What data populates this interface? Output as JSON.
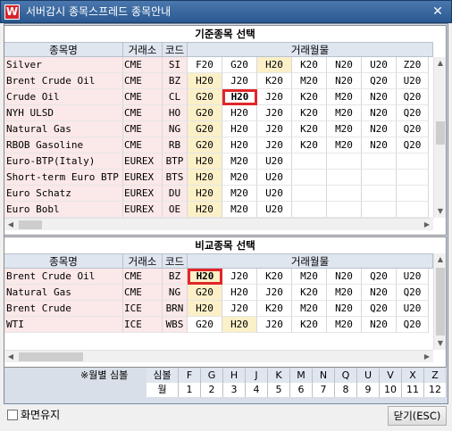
{
  "window": {
    "title": "서버감시 종목스프레드 종목안내",
    "app_icon_letter": "W",
    "close_glyph": "✕"
  },
  "columns": {
    "name": "종목명",
    "exchange": "거래소",
    "code": "코드",
    "months": "거래월물"
  },
  "base": {
    "title": "기준종목 선택",
    "rows": [
      {
        "name": "Silver",
        "exch": "CME",
        "code": "SI",
        "m": [
          "F20",
          "G20",
          "H20",
          "K20",
          "N20",
          "U20",
          "Z20"
        ],
        "hl": [
          2
        ]
      },
      {
        "name": "Brent Crude Oil",
        "exch": "CME",
        "code": "BZ",
        "m": [
          "H20",
          "J20",
          "K20",
          "M20",
          "N20",
          "Q20",
          "U20"
        ],
        "hl": [
          0
        ]
      },
      {
        "name": "Crude Oil",
        "exch": "CME",
        "code": "CL",
        "m": [
          "G20",
          "H20",
          "J20",
          "K20",
          "M20",
          "N20",
          "Q20"
        ],
        "hl": [
          0
        ],
        "sel": 1
      },
      {
        "name": "NYH ULSD",
        "exch": "CME",
        "code": "HO",
        "m": [
          "G20",
          "H20",
          "J20",
          "K20",
          "M20",
          "N20",
          "Q20"
        ],
        "hl": [
          0
        ]
      },
      {
        "name": "Natural Gas",
        "exch": "CME",
        "code": "NG",
        "m": [
          "G20",
          "H20",
          "J20",
          "K20",
          "M20",
          "N20",
          "Q20"
        ],
        "hl": [
          0
        ]
      },
      {
        "name": "RBOB Gasoline",
        "exch": "CME",
        "code": "RB",
        "m": [
          "G20",
          "H20",
          "J20",
          "K20",
          "M20",
          "N20",
          "Q20"
        ],
        "hl": [
          0
        ]
      },
      {
        "name": "Euro-BTP(Italy)",
        "exch": "EUREX",
        "code": "BTP",
        "m": [
          "H20",
          "M20",
          "U20",
          "",
          "",
          "",
          ""
        ],
        "hl": [
          0
        ]
      },
      {
        "name": "Short-term Euro BTP",
        "exch": "EUREX",
        "code": "BTS",
        "m": [
          "H20",
          "M20",
          "U20",
          "",
          "",
          "",
          ""
        ],
        "hl": [
          0
        ]
      },
      {
        "name": "Euro Schatz",
        "exch": "EUREX",
        "code": "DU",
        "m": [
          "H20",
          "M20",
          "U20",
          "",
          "",
          "",
          ""
        ],
        "hl": [
          0
        ]
      },
      {
        "name": "Euro Bobl",
        "exch": "EUREX",
        "code": "OE",
        "m": [
          "H20",
          "M20",
          "U20",
          "",
          "",
          "",
          ""
        ],
        "hl": [
          0
        ]
      }
    ]
  },
  "compare": {
    "title": "비교종목 선택",
    "rows": [
      {
        "name": "Brent Crude Oil",
        "exch": "CME",
        "code": "BZ",
        "m": [
          "H20",
          "J20",
          "K20",
          "M20",
          "N20",
          "Q20",
          "U20"
        ],
        "hl": [
          0
        ],
        "sel": 0
      },
      {
        "name": "Natural Gas",
        "exch": "CME",
        "code": "NG",
        "m": [
          "G20",
          "H20",
          "J20",
          "K20",
          "M20",
          "N20",
          "Q20"
        ],
        "hl": [
          0
        ]
      },
      {
        "name": "Brent Crude",
        "exch": "ICE",
        "code": "BRN",
        "m": [
          "H20",
          "J20",
          "K20",
          "M20",
          "N20",
          "Q20",
          "U20"
        ],
        "hl": [
          0
        ]
      },
      {
        "name": "WTI",
        "exch": "ICE",
        "code": "WBS",
        "m": [
          "G20",
          "H20",
          "J20",
          "K20",
          "M20",
          "N20",
          "Q20"
        ],
        "hl": [
          1
        ]
      }
    ]
  },
  "legend": {
    "label": "※월별 심볼",
    "symbol_header": "심볼",
    "month_header": "월",
    "symbols": [
      "F",
      "G",
      "H",
      "J",
      "K",
      "M",
      "N",
      "Q",
      "U",
      "V",
      "X",
      "Z"
    ],
    "months": [
      "1",
      "2",
      "3",
      "4",
      "5",
      "6",
      "7",
      "8",
      "9",
      "10",
      "11",
      "12"
    ]
  },
  "footer": {
    "keep_screen_label": "화면유지",
    "close_button": "닫기(ESC)",
    "keep_screen_checked": false
  }
}
